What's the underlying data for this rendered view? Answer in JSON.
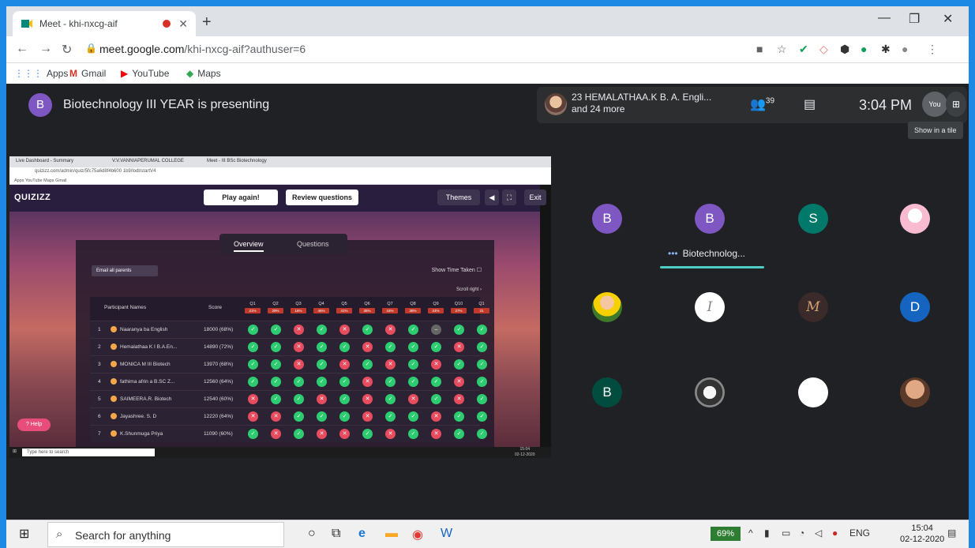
{
  "browser": {
    "tab_title": "Meet - khi-nxcg-aif",
    "url_host": "meet.google.com",
    "url_path": "/khi-nxcg-aif?authuser=6",
    "bookmarks": [
      "Apps",
      "Gmail",
      "YouTube",
      "Maps"
    ]
  },
  "meet": {
    "presenter_initial": "B",
    "presenter_title": "Biotechnology III YEAR is presenting",
    "people_line1": "23 HEMALATHAA.K B. A. Engli...",
    "people_line2": "and 24 more",
    "participants_count": "39",
    "time": "3:04 PM",
    "you_label": "You",
    "tooltip": "Show in a tile",
    "speaking_name": "Biotechnolog...",
    "tiles": [
      {
        "initial": "B",
        "color": "#7e57c2"
      },
      {
        "initial": "B",
        "color": "#7e57c2"
      },
      {
        "initial": "S",
        "color": "#00796b"
      },
      {
        "initial": "",
        "color": "#f8bbd0"
      },
      {
        "initial": "",
        "color": ""
      },
      {
        "initial": "I",
        "color": "#ffffff"
      },
      {
        "initial": "M",
        "color": "#3a2a2a"
      },
      {
        "initial": "D",
        "color": "#1565c0"
      },
      {
        "initial": "B",
        "color": "#004d40"
      },
      {
        "initial": "",
        "color": ""
      },
      {
        "initial": "",
        "color": ""
      },
      {
        "initial": "",
        "color": ""
      }
    ]
  },
  "shared": {
    "tabs": [
      "Live Dashboard - Summary",
      "V.V.VANNIAPERUMAL COLLEGE",
      "Meet - III BSc Biotechnology"
    ],
    "url": "quizizz.com/admin/quiz/5fc75a6d8f4b600 1b9/lodl/startV4",
    "bookmarks": "Apps   YouTube   Maps   Gmail",
    "logo": "QUIZIZZ",
    "play_again": "Play again!",
    "review": "Review questions",
    "themes": "Themes",
    "exit": "Exit",
    "tab_overview": "Overview",
    "tab_questions": "Questions",
    "email_parents": "Email all parents",
    "show_time": "Show Time Taken",
    "scroll_right": "Scroll right",
    "col_names": "Participant Names",
    "col_score": "Score",
    "questions": [
      {
        "q": "Q1",
        "pct": "21%"
      },
      {
        "q": "Q2",
        "pct": "29%"
      },
      {
        "q": "Q3",
        "pct": "16%"
      },
      {
        "q": "Q4",
        "pct": "45%"
      },
      {
        "q": "Q5",
        "pct": "41%"
      },
      {
        "q": "Q6",
        "pct": "35%"
      },
      {
        "q": "Q7",
        "pct": "16%"
      },
      {
        "q": "Q8",
        "pct": "38%"
      },
      {
        "q": "Q9",
        "pct": "24%"
      },
      {
        "q": "Q10",
        "pct": "27%"
      },
      {
        "q": "Q1",
        "pct": "31"
      }
    ],
    "rows": [
      {
        "n": "1",
        "name": "Naaranya ba English",
        "score": "18000 (68%)",
        "marks": "ccwcwcwcsc c"
      },
      {
        "n": "2",
        "name": "Hemalathaa K I B.A.En...",
        "score": "14890 (72%)",
        "marks": "ccwccwcccwc"
      },
      {
        "n": "3",
        "name": "MONICA M III Biotech",
        "score": "13970 (68%)",
        "marks": "ccwcwcwcwcc"
      },
      {
        "n": "4",
        "name": "fathima afrin a B.SC Z...",
        "score": "12560 (64%)",
        "marks": "cccccwcccwc"
      },
      {
        "n": "5",
        "name": "SAIMEERA.R. Biotech",
        "score": "12540 (60%)",
        "marks": "wccwcwcwcwc"
      },
      {
        "n": "6",
        "name": "Jayashree. S. D",
        "score": "12220 (64%)",
        "marks": "wwcccwccwcc"
      },
      {
        "n": "7",
        "name": "K.Shunmuga Priya",
        "score": "11090 (60%)",
        "marks": "cwcwwcwcwcc"
      }
    ],
    "help": "Help",
    "taskbar_search": "Type here to search",
    "taskbar_time": "15:04",
    "taskbar_date": "02-12-2020"
  },
  "taskbar": {
    "search_placeholder": "Search for anything",
    "battery": "69%",
    "lang": "ENG",
    "time": "15:04",
    "date": "02-12-2020"
  }
}
